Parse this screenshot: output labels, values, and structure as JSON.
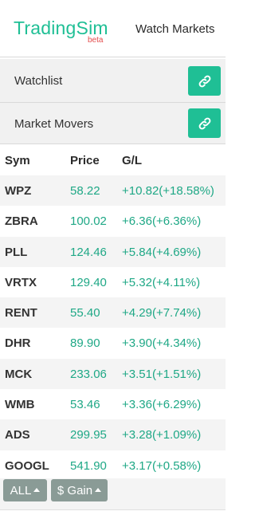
{
  "header": {
    "logo": "TradingSim",
    "logo_badge": "beta",
    "nav_title": "Watch Markets"
  },
  "sections": {
    "watchlist_label": "Watchlist",
    "movers_label": "Market Movers",
    "link_icon": "link-icon"
  },
  "table": {
    "headers": [
      "Sym",
      "Price",
      "G/L"
    ],
    "rows": [
      {
        "sym": "WPZ",
        "price": "58.22",
        "gl": "+10.82(+18.58%)"
      },
      {
        "sym": "ZBRA",
        "price": "100.02",
        "gl": "+6.36(+6.36%)"
      },
      {
        "sym": "PLL",
        "price": "124.46",
        "gl": "+5.84(+4.69%)"
      },
      {
        "sym": "VRTX",
        "price": "129.40",
        "gl": "+5.32(+4.11%)"
      },
      {
        "sym": "RENT",
        "price": "55.40",
        "gl": "+4.29(+7.74%)"
      },
      {
        "sym": "DHR",
        "price": "89.90",
        "gl": "+3.90(+4.34%)"
      },
      {
        "sym": "MCK",
        "price": "233.06",
        "gl": "+3.51(+1.51%)"
      },
      {
        "sym": "WMB",
        "price": "53.46",
        "gl": "+3.36(+6.29%)"
      },
      {
        "sym": "ADS",
        "price": "299.95",
        "gl": "+3.28(+1.09%)"
      },
      {
        "sym": "GOOGL",
        "price": "541.90",
        "gl": "+3.17(+0.58%)"
      }
    ]
  },
  "controls": {
    "filter_label": "ALL",
    "sort_label": "$ Gain"
  },
  "colors": {
    "brand": "#1fbf95",
    "gain": "#1fa886",
    "badge": "#e34b4b",
    "control": "#8a9b96"
  }
}
